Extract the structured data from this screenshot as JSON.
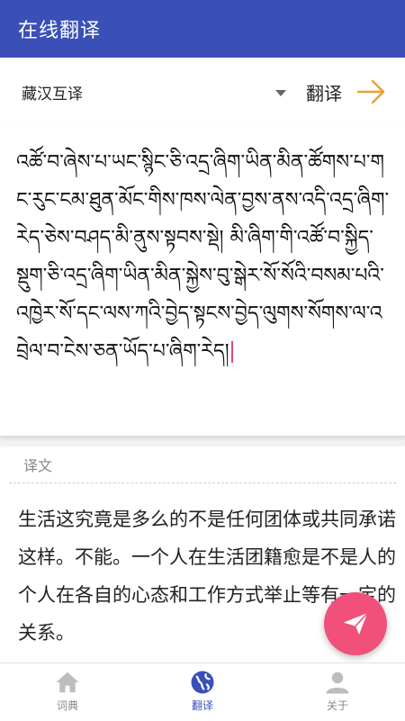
{
  "app": {
    "title": "在线翻译"
  },
  "lang_bar": {
    "selected": "藏汉互译",
    "translate_label": "翻译"
  },
  "input": {
    "text": "འཚོ་བ་ཞེས་པ་ཡང་སྙིང་ཅི་འདྲ་ཞིག་ཡིན་མིན་ཚོགས་པ་གང་རུང་ངམ་ཐུན་མོང་གིས་ཁས་ལེན་བྱས་ནས་འདི་འདྲ་ཞིག་རེད་ཅེས་བཤད་མི་ནུས་སྟབས་སྡེ། མི་ཞིག་གི་འཚོ་བ་སྐྱིད་སྡུག་ཅི་འདྲ་ཞིག་ཡིན་མིན་སྐྱེས་བུ་སྒེར་སོ་སོའི་བསམ་པའི་འཁྱེར་སོ་དང་ལས་ཀའི་བྱེད་སྟངས་བྱེད་ལུགས་སོགས་ལ་འབྲེལ་བ་ངེས་ཅན་ཡོད་པ་ཞིག་རེད།"
  },
  "result": {
    "label": "译文",
    "text": "生活这究竟是多么的不是任何团体或共同承诺这样。不能。一个人在生活团籍愈是不是人的个人在各自的心态和工作方式举止等有一定的关系。"
  },
  "nav": [
    {
      "label": "词典",
      "icon": "home-icon",
      "active": false
    },
    {
      "label": "翻译",
      "icon": "globe-icon",
      "active": true
    },
    {
      "label": "关于",
      "icon": "person-icon",
      "active": false
    }
  ],
  "colors": {
    "primary": "#3b4fb8",
    "accent": "#f0507a",
    "arrow": "#f0a030"
  }
}
